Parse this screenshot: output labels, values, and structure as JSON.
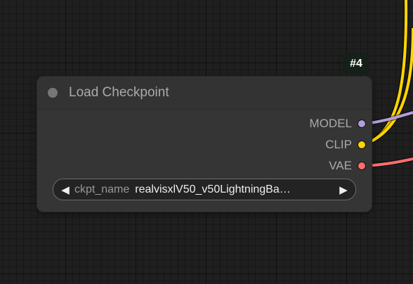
{
  "node": {
    "id_badge": "#4",
    "title": "Load Checkpoint",
    "outputs": [
      {
        "label": "MODEL",
        "color": "#b39ddb"
      },
      {
        "label": "CLIP",
        "color": "#ffd500"
      },
      {
        "label": "VAE",
        "color": "#ff6e6e"
      }
    ],
    "widget": {
      "name": "ckpt_name",
      "value": "realvisxlV50_v50LightningBa…",
      "prev_icon": "◀",
      "next_icon": "▶"
    }
  },
  "colors": {
    "canvas_bg": "#1f1f1f",
    "node_bg": "#353535",
    "link_clip": "#ffd500",
    "link_model": "#b39ddb",
    "link_vae": "#ff6e6e"
  },
  "icons": {
    "collapse": "collapse-dot-icon"
  }
}
